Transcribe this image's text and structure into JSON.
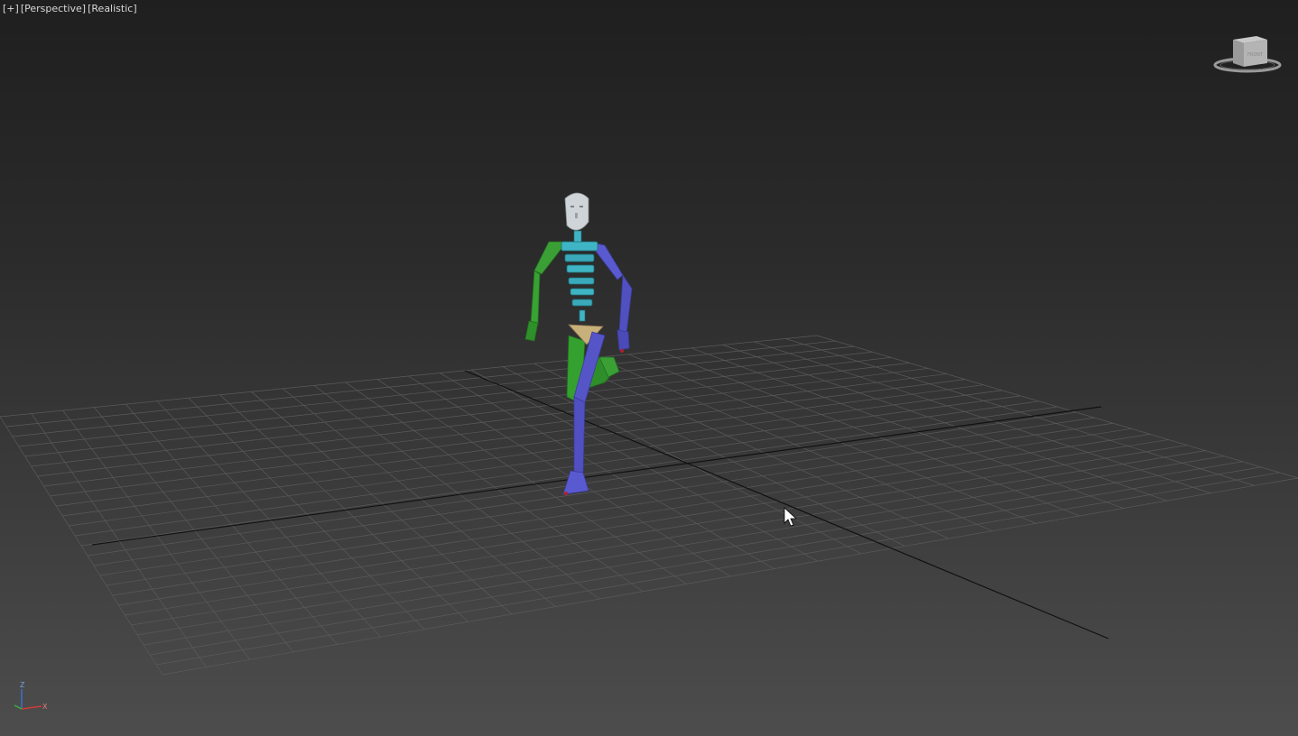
{
  "viewport": {
    "menu_label": "[+]",
    "view_label": "[Perspective]",
    "shading_label": "[Realistic]"
  },
  "viewcube": {
    "face_label": "FRONT"
  },
  "axis_tripod": {
    "z": "Z",
    "x": "X",
    "y": "Y"
  },
  "colors": {
    "grid_line": "#5a5a5a",
    "grid_axis": "#111111",
    "biped_left": "#3a9a35",
    "biped_right": "#5555c8",
    "spine": "#3fb4c4",
    "pelvis": "#c8b07a",
    "head": "#d0d4d8"
  }
}
